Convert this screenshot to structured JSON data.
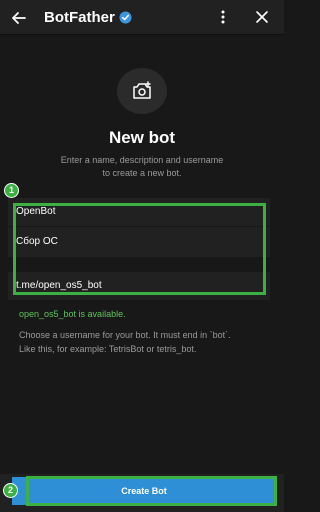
{
  "header": {
    "title": "BotFather",
    "back_icon": "arrow-left-icon",
    "verified_icon": "verified-badge-icon",
    "menu_icon": "more-vertical-icon",
    "close_icon": "close-icon"
  },
  "avatar": {
    "icon": "camera-add-icon"
  },
  "heading": "New bot",
  "subtitle": {
    "line1": "Enter a name, description and username",
    "line2": "to create a new bot."
  },
  "form": {
    "name_value": "OpenBot",
    "description_value": "Сбор ОС",
    "username_value": "t.me/open_os5_bot"
  },
  "availability": "open_os5_bot is available.",
  "hint": {
    "line1": "Choose a username for your bot. It must end in `bot`.",
    "line2": "Like this, for example: TetrisBot or tetris_bot."
  },
  "create_button": "Create Bot",
  "annotations": {
    "step1": "1",
    "step2": "2",
    "highlight_color": "#3cb043"
  },
  "colors": {
    "accent": "#2e8fd6",
    "success": "#5ec45a",
    "background": "#181818"
  }
}
